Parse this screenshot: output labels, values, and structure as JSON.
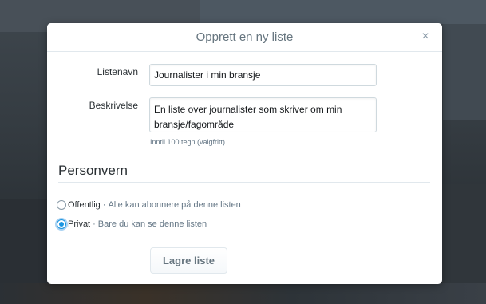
{
  "dialog": {
    "title": "Opprett en ny liste",
    "close_label": "×"
  },
  "form": {
    "name_label": "Listenavn",
    "name_value": "Journalister i min bransje",
    "description_label": "Beskrivelse",
    "description_value": "En liste over journalister som skriver om min bransje/fagområde",
    "description_hint": "Inntil 100 tegn (valgfritt)"
  },
  "privacy": {
    "heading": "Personvern",
    "separator": "·",
    "options": [
      {
        "label": "Offentlig",
        "description": "Alle kan abonnere på denne listen",
        "checked": false
      },
      {
        "label": "Privat",
        "description": "Bare du kan se denne listen",
        "checked": true
      }
    ]
  },
  "actions": {
    "save_label": "Lagre liste"
  },
  "colors": {
    "accent": "#1b95e0",
    "muted_text": "#657786"
  },
  "icons": {
    "close": "close-icon"
  }
}
